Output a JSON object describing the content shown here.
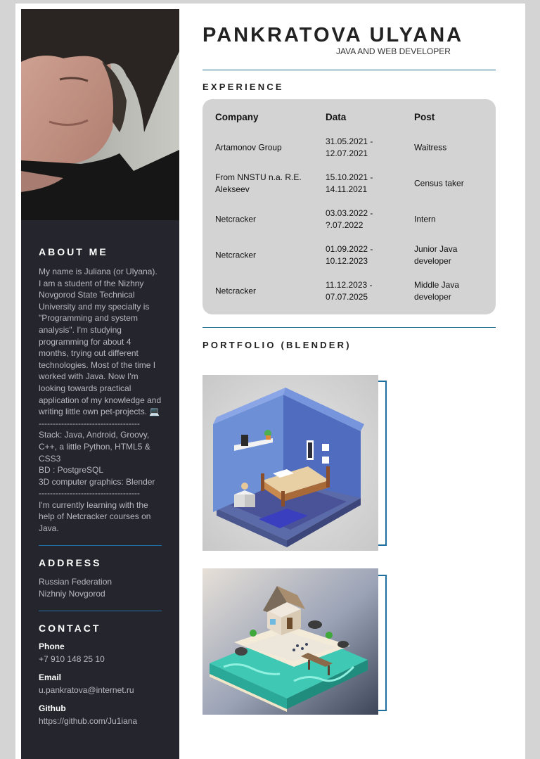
{
  "header": {
    "name": "PANKRATOVA ULYANA",
    "role": "JAVA AND WEB DEVELOPER"
  },
  "sidebar": {
    "about_title": "ABOUT ME",
    "about_paragraphs": [
      "My name is Juliana (or Ulyana). I am a student of the Nizhny Novgorod State Technical University and my specialty is \"Programming and system analysis\". I'm studying programming for about 4 months, trying out different technologies. Most of the time I worked with Java. Now I'm looking towards practical application of my knowledge and writing little own pet-projects. 💻",
      "------------------------------------",
      "Stack: Java, Android, Groovy, C++, a little Python, HTML5 & CSS3",
      "BD : PostgreSQL",
      "3D computer graphics: Blender",
      "------------------------------------",
      "I'm currently learning with the help of Netcracker courses on Java."
    ],
    "address_title": "ADDRESS",
    "address_lines": [
      "Russian Federation",
      "Nizhniy Novgorod"
    ],
    "contact_title": "CONTACT",
    "contacts": [
      {
        "label": "Phone",
        "value": "+7 910 148 25 10"
      },
      {
        "label": "Email",
        "value": "u.pankratova@internet.ru"
      },
      {
        "label": "Github",
        "value": "https://github.com/Ju1iana"
      }
    ]
  },
  "experience": {
    "title": "EXPERIENCE",
    "headers": {
      "company": "Company",
      "date": "Data",
      "post": "Post"
    },
    "rows": [
      {
        "company": "Artamonov Group",
        "date": "31.05.2021 - 12.07.2021",
        "post": "Waitress"
      },
      {
        "company": "From NNSTU n.a. R.E. Alekseev",
        "date": "15.10.2021 - 14.11.2021",
        "post": "Census taker"
      },
      {
        "company": "Netcracker",
        "date": "03.03.2022 - ?.07.2022",
        "post": "Intern"
      },
      {
        "company": "Netcracker",
        "date": "01.09.2022 - 10.12.2023",
        "post": "Junior Java developer"
      },
      {
        "company": "Netcracker",
        "date": "11.12.2023 - 07.07.2025",
        "post": "Middle Java developer"
      }
    ]
  },
  "portfolio": {
    "title": "PORTFOLIO (BLENDER)"
  },
  "colors": {
    "sidebar_bg": "#25252d",
    "accent_line": "#1e6f9f",
    "table_bg": "#d3d3d3"
  }
}
